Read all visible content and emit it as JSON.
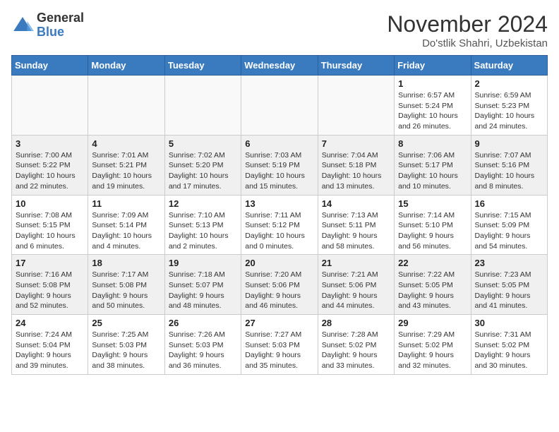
{
  "logo": {
    "general": "General",
    "blue": "Blue"
  },
  "title": "November 2024",
  "location": "Do'stlik Shahri, Uzbekistan",
  "days_of_week": [
    "Sunday",
    "Monday",
    "Tuesday",
    "Wednesday",
    "Thursday",
    "Friday",
    "Saturday"
  ],
  "weeks": [
    [
      {
        "day": "",
        "info": "",
        "empty": true
      },
      {
        "day": "",
        "info": "",
        "empty": true
      },
      {
        "day": "",
        "info": "",
        "empty": true
      },
      {
        "day": "",
        "info": "",
        "empty": true
      },
      {
        "day": "",
        "info": "",
        "empty": true
      },
      {
        "day": "1",
        "info": "Sunrise: 6:57 AM\nSunset: 5:24 PM\nDaylight: 10 hours and 26 minutes."
      },
      {
        "day": "2",
        "info": "Sunrise: 6:59 AM\nSunset: 5:23 PM\nDaylight: 10 hours and 24 minutes."
      }
    ],
    [
      {
        "day": "3",
        "info": "Sunrise: 7:00 AM\nSunset: 5:22 PM\nDaylight: 10 hours and 22 minutes."
      },
      {
        "day": "4",
        "info": "Sunrise: 7:01 AM\nSunset: 5:21 PM\nDaylight: 10 hours and 19 minutes."
      },
      {
        "day": "5",
        "info": "Sunrise: 7:02 AM\nSunset: 5:20 PM\nDaylight: 10 hours and 17 minutes."
      },
      {
        "day": "6",
        "info": "Sunrise: 7:03 AM\nSunset: 5:19 PM\nDaylight: 10 hours and 15 minutes."
      },
      {
        "day": "7",
        "info": "Sunrise: 7:04 AM\nSunset: 5:18 PM\nDaylight: 10 hours and 13 minutes."
      },
      {
        "day": "8",
        "info": "Sunrise: 7:06 AM\nSunset: 5:17 PM\nDaylight: 10 hours and 10 minutes."
      },
      {
        "day": "9",
        "info": "Sunrise: 7:07 AM\nSunset: 5:16 PM\nDaylight: 10 hours and 8 minutes."
      }
    ],
    [
      {
        "day": "10",
        "info": "Sunrise: 7:08 AM\nSunset: 5:15 PM\nDaylight: 10 hours and 6 minutes."
      },
      {
        "day": "11",
        "info": "Sunrise: 7:09 AM\nSunset: 5:14 PM\nDaylight: 10 hours and 4 minutes."
      },
      {
        "day": "12",
        "info": "Sunrise: 7:10 AM\nSunset: 5:13 PM\nDaylight: 10 hours and 2 minutes."
      },
      {
        "day": "13",
        "info": "Sunrise: 7:11 AM\nSunset: 5:12 PM\nDaylight: 10 hours and 0 minutes."
      },
      {
        "day": "14",
        "info": "Sunrise: 7:13 AM\nSunset: 5:11 PM\nDaylight: 9 hours and 58 minutes."
      },
      {
        "day": "15",
        "info": "Sunrise: 7:14 AM\nSunset: 5:10 PM\nDaylight: 9 hours and 56 minutes."
      },
      {
        "day": "16",
        "info": "Sunrise: 7:15 AM\nSunset: 5:09 PM\nDaylight: 9 hours and 54 minutes."
      }
    ],
    [
      {
        "day": "17",
        "info": "Sunrise: 7:16 AM\nSunset: 5:08 PM\nDaylight: 9 hours and 52 minutes."
      },
      {
        "day": "18",
        "info": "Sunrise: 7:17 AM\nSunset: 5:08 PM\nDaylight: 9 hours and 50 minutes."
      },
      {
        "day": "19",
        "info": "Sunrise: 7:18 AM\nSunset: 5:07 PM\nDaylight: 9 hours and 48 minutes."
      },
      {
        "day": "20",
        "info": "Sunrise: 7:20 AM\nSunset: 5:06 PM\nDaylight: 9 hours and 46 minutes."
      },
      {
        "day": "21",
        "info": "Sunrise: 7:21 AM\nSunset: 5:06 PM\nDaylight: 9 hours and 44 minutes."
      },
      {
        "day": "22",
        "info": "Sunrise: 7:22 AM\nSunset: 5:05 PM\nDaylight: 9 hours and 43 minutes."
      },
      {
        "day": "23",
        "info": "Sunrise: 7:23 AM\nSunset: 5:05 PM\nDaylight: 9 hours and 41 minutes."
      }
    ],
    [
      {
        "day": "24",
        "info": "Sunrise: 7:24 AM\nSunset: 5:04 PM\nDaylight: 9 hours and 39 minutes."
      },
      {
        "day": "25",
        "info": "Sunrise: 7:25 AM\nSunset: 5:03 PM\nDaylight: 9 hours and 38 minutes."
      },
      {
        "day": "26",
        "info": "Sunrise: 7:26 AM\nSunset: 5:03 PM\nDaylight: 9 hours and 36 minutes."
      },
      {
        "day": "27",
        "info": "Sunrise: 7:27 AM\nSunset: 5:03 PM\nDaylight: 9 hours and 35 minutes."
      },
      {
        "day": "28",
        "info": "Sunrise: 7:28 AM\nSunset: 5:02 PM\nDaylight: 9 hours and 33 minutes."
      },
      {
        "day": "29",
        "info": "Sunrise: 7:29 AM\nSunset: 5:02 PM\nDaylight: 9 hours and 32 minutes."
      },
      {
        "day": "30",
        "info": "Sunrise: 7:31 AM\nSunset: 5:02 PM\nDaylight: 9 hours and 30 minutes."
      }
    ]
  ]
}
